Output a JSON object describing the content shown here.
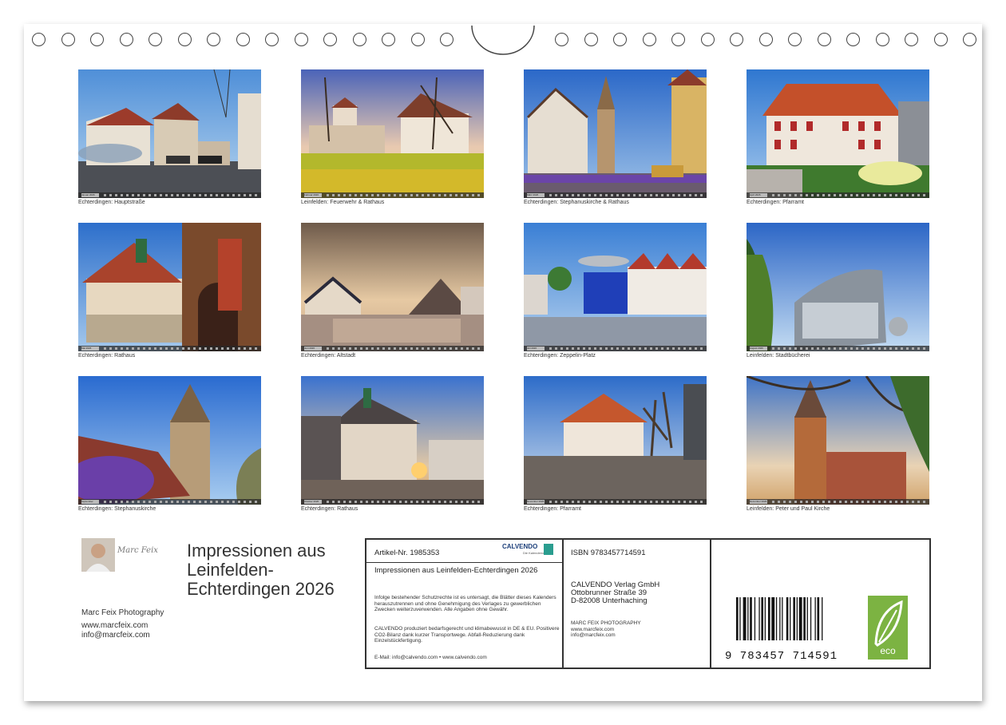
{
  "photos": [
    {
      "month": "Januar 2026",
      "caption": "Echterdingen: Hauptstraße"
    },
    {
      "month": "Februar 2026",
      "caption": "Leinfelden: Feuerwehr & Rathaus"
    },
    {
      "month": "März 2026",
      "caption": "Echterdingen: Stephanuskirche & Rathaus"
    },
    {
      "month": "April 2026",
      "caption": "Echterdingen: Pfarramt"
    },
    {
      "month": "Mai 2026",
      "caption": "Echterdingen: Rathaus"
    },
    {
      "month": "Juni 2026",
      "caption": "Echterdingen: Altstadt"
    },
    {
      "month": "Juli 2026",
      "caption": "Echterdingen: Zeppelin-Platz"
    },
    {
      "month": "August 2026",
      "caption": "Leinfelden: Stadtbücherei"
    },
    {
      "month": "September 2026",
      "caption": "Echterdingen: Stephanuskirche"
    },
    {
      "month": "Oktober 2026",
      "caption": "Echterdingen: Rathaus"
    },
    {
      "month": "November 2026",
      "caption": "Echterdingen: Pfarramt"
    },
    {
      "month": "Dezember 2026",
      "caption": "Leinfelden: Peter und Paul Kirche"
    }
  ],
  "author": {
    "signature": "Marc Feix",
    "title": "Impressionen aus Leinfelden-Echterdingen 2026",
    "name": "Marc Feix Photography",
    "web": "www.marcfeix.com",
    "email": "info@marcfeix.com"
  },
  "imprint": {
    "article": "Artikel-Nr. 1985353",
    "logo": "CALVENDO",
    "logo_sub": "Die Kalenderverlag",
    "product_title": "Impressionen aus Leinfelden-Echterdingen 2026",
    "legal": "Infolge bestehender Schutzrechte ist es untersagt, die Blätter dieses Kalenders herauszutrennen und ohne Genehmigung des Verlages zu gewerblichen Zwecken weiterzuverwenden. Alle Angaben ohne Gewähr.",
    "eco_text": "CALVENDO produziert bedarfsgerecht und klimabewusst in DE & EU. Positivere CO2-Bilanz dank kurzer Transportwege. Abfall-Reduzierung dank Einzelstückfertigung.",
    "contact": "E-Mail: info@calvendo.com • www.calvendo.com",
    "isbn": "ISBN 9783457714591",
    "publisher_name": "CALVENDO Verlag GmbH",
    "publisher_street": "Ottobrunner Straße 39",
    "publisher_city": "D-82008 Unterhaching",
    "copyright_name": "MARC FEIX PHOTOGRAPHY",
    "copyright_web": "www.marcfeix.com",
    "copyright_email": "info@marcfeix.com",
    "barcode_number": "9 783457 714591",
    "eco_label": "eco"
  }
}
